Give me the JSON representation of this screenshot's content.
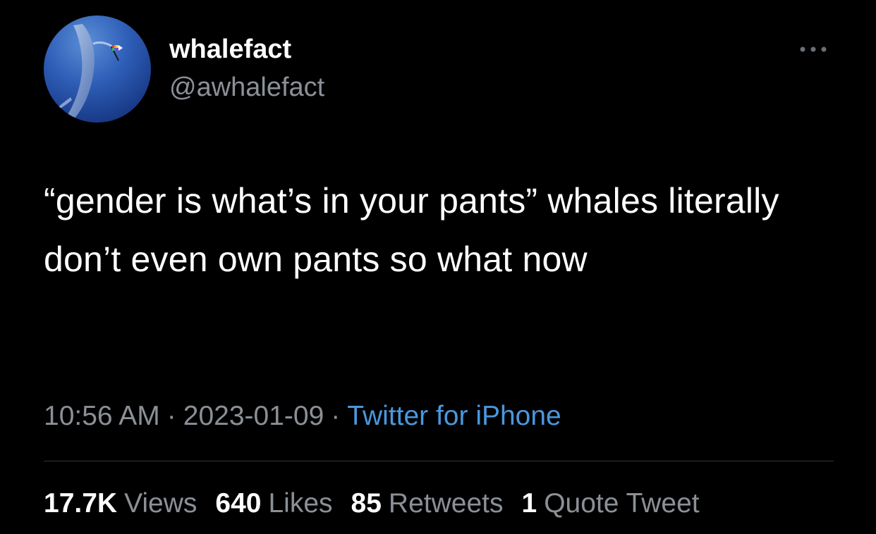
{
  "tweet": {
    "author": {
      "display_name": "whalefact",
      "handle": "@awhalefact",
      "avatar_icon": "whale-with-flag-avatar"
    },
    "text": "“gender is what’s in your pants” whales literally don’t even own pants so what now",
    "time": "10:56 AM",
    "separator": "·",
    "date": "2023-01-09",
    "source": "Twitter for iPhone",
    "stats": [
      {
        "count": "17.7K",
        "label": "Views"
      },
      {
        "count": "640",
        "label": "Likes"
      },
      {
        "count": "85",
        "label": "Retweets"
      },
      {
        "count": "1",
        "label": "Quote Tweet"
      }
    ],
    "more_icon": "more-options-icon"
  },
  "colors": {
    "background": "#000000",
    "primary_text": "#ffffff",
    "secondary_text": "#8b9096",
    "link": "#4a97dd",
    "divider": "#2f3336"
  }
}
